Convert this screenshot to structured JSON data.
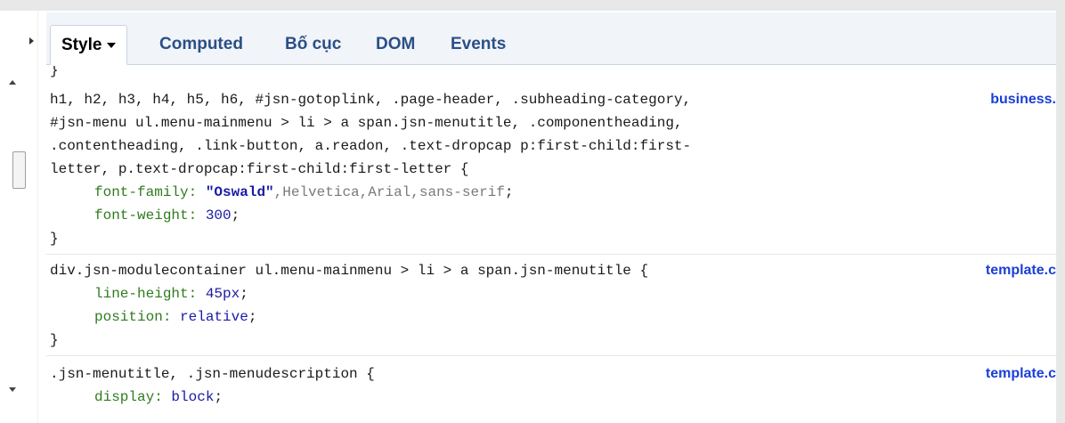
{
  "tabs": {
    "style": "Style",
    "computed": "Computed",
    "layout": "Bố cục",
    "dom": "DOM",
    "events": "Events"
  },
  "rules": [
    {
      "prev_close": "}"
    },
    {
      "selector_lines": [
        "h1, h2, h3, h4, h5, h6, #jsn-gotoplink, .page-header, .subheading-category,",
        "#jsn-menu ul.menu-mainmenu > li > a span.jsn-menutitle, .componentheading,",
        ".contentheading, .link-button, a.readon, .text-dropcap p:first-child:first-",
        "letter, p.text-dropcap:first-child:first-letter {"
      ],
      "source": "business.",
      "decl1_prop": "font-family",
      "decl1_val_str": "\"Oswald\"",
      "decl1_val_rest": ",Helvetica,Arial,sans-serif",
      "decl2_prop": "font-weight",
      "decl2_val": "300",
      "close": "}"
    },
    {
      "selector": "div.jsn-modulecontainer ul.menu-mainmenu > li > a span.jsn-menutitle {",
      "source": "template.c",
      "decl1_prop": "line-height",
      "decl1_val": "45px",
      "decl2_prop": "position",
      "decl2_val": "relative",
      "close": "}"
    },
    {
      "selector": ".jsn-menutitle, .jsn-menudescription {",
      "source": "template.c",
      "decl1_prop": "display",
      "decl1_val": "block"
    }
  ],
  "icons": [
    "expand-arrow-icon",
    "scroll-up-icon",
    "scroll-down-icon"
  ],
  "colors": {
    "tab_link": "#2b4f86",
    "property": "#2f7c1e",
    "value": "#1a1aa6",
    "source_link": "#1a3fd6"
  }
}
